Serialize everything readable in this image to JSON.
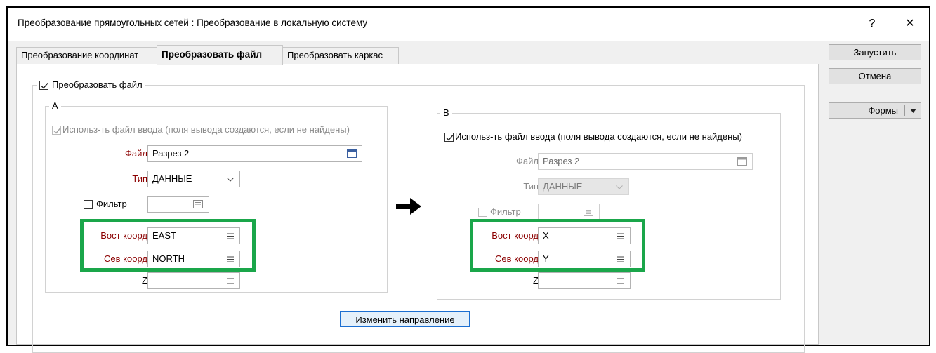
{
  "window": {
    "title": "Преобразование прямоугольных сетей : Преобразование в локальную систему",
    "help_label": "?",
    "close_label": "✕"
  },
  "tabs": [
    {
      "label": "Преобразование координат",
      "active": false
    },
    {
      "label": "Преобразовать файл",
      "active": true
    },
    {
      "label": "Преобразовать каркас",
      "active": false
    }
  ],
  "main": {
    "convert_checkbox": {
      "label": "Преобразовать файл",
      "checked": true
    },
    "arrow_icon": "right-arrow-icon",
    "swap_button": "Изменить направление"
  },
  "panel_a": {
    "title": "А",
    "use_input": {
      "label": "Использ-ть файл ввода (поля вывода создаются, если не найдены)",
      "checked": true,
      "disabled": true
    },
    "file_label": "Файл",
    "file_value": "Разрез 2",
    "type_label": "Тип",
    "type_value": "ДАННЫЕ",
    "filter_label": "Фильтр",
    "filter_checked": false,
    "east_label": "Вост коорд",
    "east_value": "EAST",
    "north_label": "Сев коорд",
    "north_value": "NORTH",
    "z_label": "Z",
    "z_value": ""
  },
  "panel_b": {
    "title": "В",
    "use_input": {
      "label": "Использ-ть файл ввода (поля вывода создаются, если не найдены)",
      "checked": true,
      "disabled": false
    },
    "file_label": "Файл",
    "file_value": "Разрез 2",
    "type_label": "Тип",
    "type_value": "ДАННЫЕ",
    "filter_label": "Фильтр",
    "filter_checked": false,
    "east_label": "Вост коорд",
    "east_value": "X",
    "north_label": "Сев коорд",
    "north_value": "Y",
    "z_label": "Z",
    "z_value": ""
  },
  "sidebar": {
    "run_button": "Запустить",
    "cancel_button": "Отмена",
    "forms_button": "Формы"
  },
  "colors": {
    "highlight_box": "#1aa64a",
    "required_label": "#8b0000",
    "disabled_text": "#8a8a8a"
  }
}
